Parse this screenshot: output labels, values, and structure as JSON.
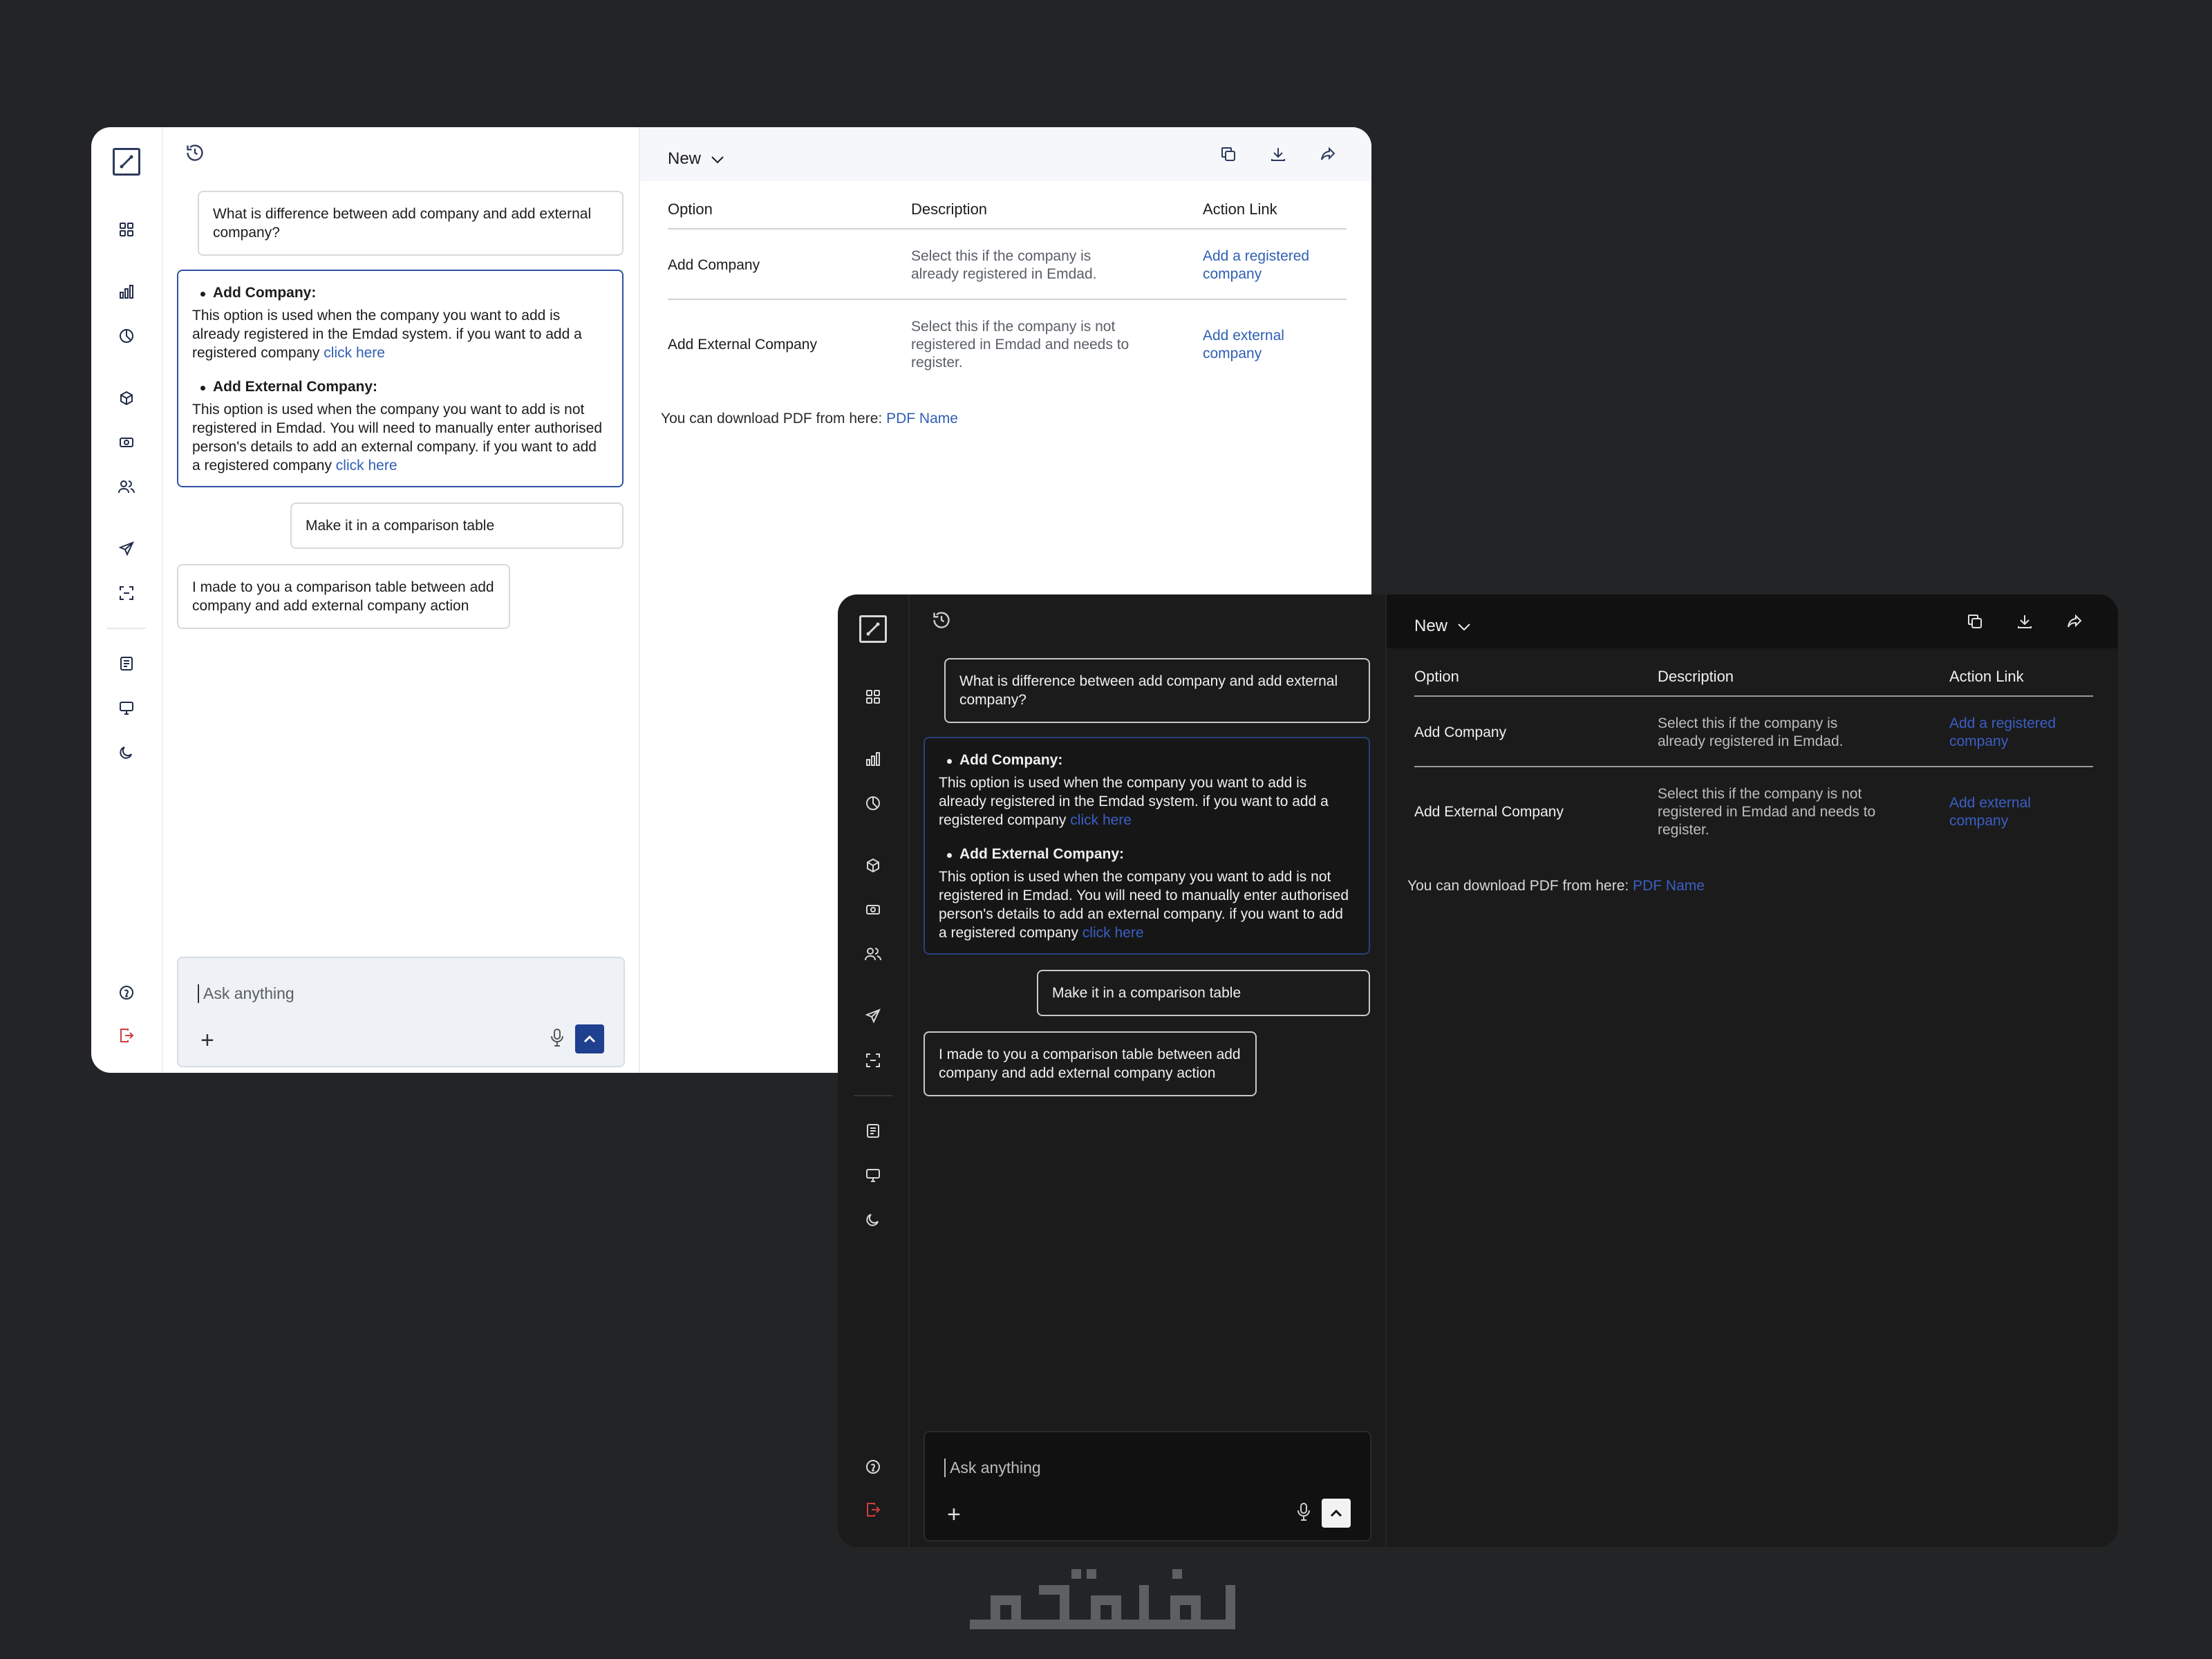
{
  "colors": {
    "page_bg": "#232425",
    "accent_blue": "#1f3f8f",
    "link": "#2f5fb3",
    "logout_red": "#d23c3c",
    "dark_window_bg": "#1b1b1b"
  },
  "icons": {
    "rail": [
      "logo-icon",
      "grid-icon",
      "bar-chart-icon",
      "pie-chart-icon",
      "cube-icon",
      "cash-icon",
      "users-icon",
      "send-icon",
      "scan-icon",
      "report-icon",
      "monitor-icon",
      "moon-icon",
      "help-icon",
      "logout-icon"
    ],
    "chat_header": "history-icon",
    "doc_actions": [
      "copy-icon",
      "download-icon",
      "share-icon"
    ]
  },
  "chat": {
    "user_msg_1": "What is difference between add company and add external company?",
    "ai_msg_1": {
      "item1_title": "Add Company:",
      "item1_text": "This option is used when the company you want to add is already registered in the Emdad system. if you want to add a registered company",
      "item1_link": "click here",
      "item2_title": "Add External Company:",
      "item2_text": "This option is used when the company you want to add is not registered in Emdad. You will need to manually enter authorised person's details to add an external company. if you want to add a registered company",
      "item2_link": "click here"
    },
    "user_msg_2": "Make it in a comparison table",
    "ai_msg_2": "I made to you a comparison table between add company and add external company action",
    "composer_placeholder": "Ask anything",
    "plus_label": "+"
  },
  "document": {
    "title": "New",
    "table": {
      "headers": [
        "Option",
        "Description",
        "Action Link"
      ],
      "rows": [
        {
          "option": "Add Company",
          "description": "Select this if the company is already registered in Emdad.",
          "action": "Add a registered company"
        },
        {
          "option": "Add External Company",
          "description": "Select this if the company is not registered in Emdad and needs to register.",
          "action": "Add external company"
        }
      ]
    },
    "pdf_prefix": "You can download PDF from here: ",
    "pdf_link": "PDF Name"
  },
  "brand_logo": "خدمات"
}
